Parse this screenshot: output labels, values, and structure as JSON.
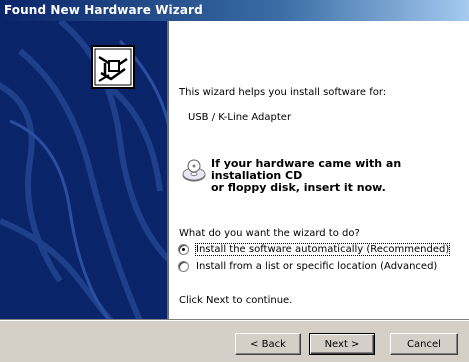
{
  "window": {
    "title": "Found New Hardware Wizard"
  },
  "content": {
    "intro": "This wizard helps you install software for:",
    "device_name": "USB / K-Line Adapter",
    "cd_note_line1": "If your hardware came with an installation CD",
    "cd_note_line2": "or floppy disk, insert it now.",
    "question": "What do you want the wizard to do?",
    "options": [
      {
        "label": "Install the software automatically (Recommended)",
        "selected": true
      },
      {
        "label": "Install from a list or specific location (Advanced)",
        "selected": false
      }
    ],
    "continue_text": "Click Next to continue."
  },
  "buttons": {
    "back": "< Back",
    "next": "Next >",
    "cancel": "Cancel"
  },
  "colors": {
    "sidebar": "#0a246a",
    "dialog_face": "#d4d0c8"
  },
  "icons": {
    "sidebar_logo": "hardware-box-icon",
    "cd": "cd-disk-icon"
  }
}
